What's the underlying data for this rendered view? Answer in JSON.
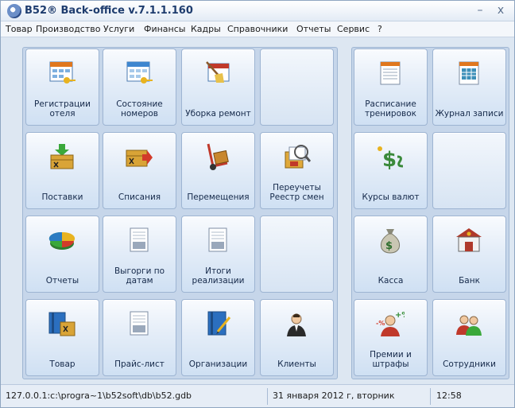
{
  "window": {
    "title": "B52® Back-office  v.7.1.1.160",
    "minimize_glyph": "–",
    "close_glyph": "x"
  },
  "menu": [
    "Товар",
    "Производство",
    "Услуги",
    "Финансы",
    "Кадры",
    "Справочники",
    "Отчеты",
    "Сервис",
    "?"
  ],
  "tiles": {
    "registrations": "Регистрации отеля",
    "room_status": "Состояние номеров",
    "cleaning": "Уборка ремонт",
    "training_schedule": "Расписание тренировок",
    "booking_log": "Журнал записи",
    "supplies": "Поставки",
    "writeoffs": "Списания",
    "transfers": "Перемещения",
    "recounts": "Переучеты Реестр смен",
    "currency_rates": "Курсы валют",
    "reports": "Отчеты",
    "sales_by_date": "Выгорги по датам",
    "sales_totals": "Итоги реализации",
    "cash": "Касса",
    "bank": "Банк",
    "goods": "Товар",
    "price_list": "Прайс-лист",
    "organizations": "Организации",
    "clients": "Клиенты",
    "bonuses": "Премии и штрафы",
    "employees": "Сотрудники"
  },
  "icons": {
    "registrations": "hotel-registration-icon",
    "room_status": "room-status-icon",
    "cleaning": "cleaning-broom-icon",
    "training_schedule": "schedule-icon",
    "booking_log": "journal-icon",
    "supplies": "box-in-icon",
    "writeoffs": "box-out-icon",
    "transfers": "hand-truck-icon",
    "recounts": "inventory-icon",
    "currency_rates": "currency-icon",
    "reports": "pie-chart-icon",
    "sales_by_date": "cash-register-icon",
    "sales_totals": "cash-register-icon",
    "cash": "money-bag-icon",
    "bank": "bank-icon",
    "goods": "book-goods-icon",
    "price_list": "price-list-icon",
    "organizations": "notebook-icon",
    "clients": "person-icon",
    "bonuses": "bonus-penalty-icon",
    "employees": "people-icon"
  },
  "currency_glyph": "$",
  "bonus_text": "+%",
  "penalty_text": "-%",
  "status": {
    "path": "127.0.0.1:c:\\progra~1\\b52soft\\db\\b52.gdb",
    "date": "31 января 2012 г, вторник",
    "time": "12:58"
  },
  "colors": {
    "tile_top": "#f9fbfe",
    "tile_bottom": "#cfe0f3",
    "title_text": "#1e3c6e",
    "group_bg": "#c6d6ea"
  }
}
